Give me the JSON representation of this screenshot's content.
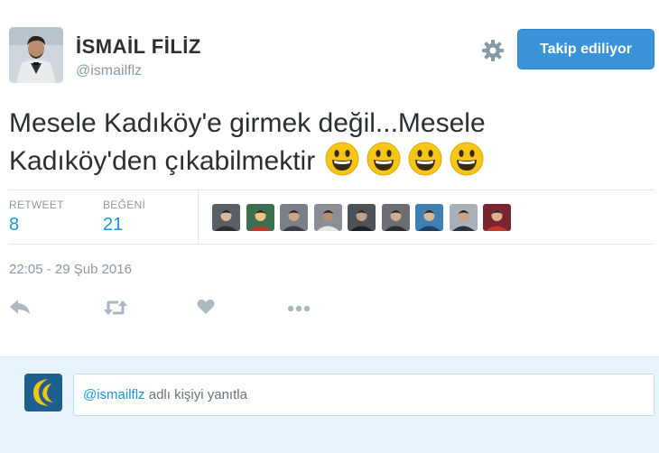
{
  "user": {
    "display_name": "İSMAİL FİLİZ",
    "handle": "@ismailflz"
  },
  "follow_button_label": "Takip ediliyor",
  "tweet": {
    "text": "Mesele Kadıköy'e girmek değil...Mesele Kadıköy'den çıkabilmektir",
    "emoji_count": 4
  },
  "stats": {
    "retweet_label": "RETWEET",
    "retweet_count": "8",
    "like_label": "BEĞENİ",
    "like_count": "21"
  },
  "likers_count": 9,
  "timestamp": "22:05 - 29 Şub 2016",
  "actions": [
    "reply-icon",
    "retweet-icon",
    "heart-icon",
    "more-icon"
  ],
  "reply": {
    "mention": "@ismailflz",
    "placeholder_rest": " adlı kişiyi yanıtla"
  },
  "colors": {
    "accent": "#1b95e0",
    "button": "#3b94d9",
    "muted": "#8899a6",
    "reply_bg": "#e8f4fb"
  }
}
